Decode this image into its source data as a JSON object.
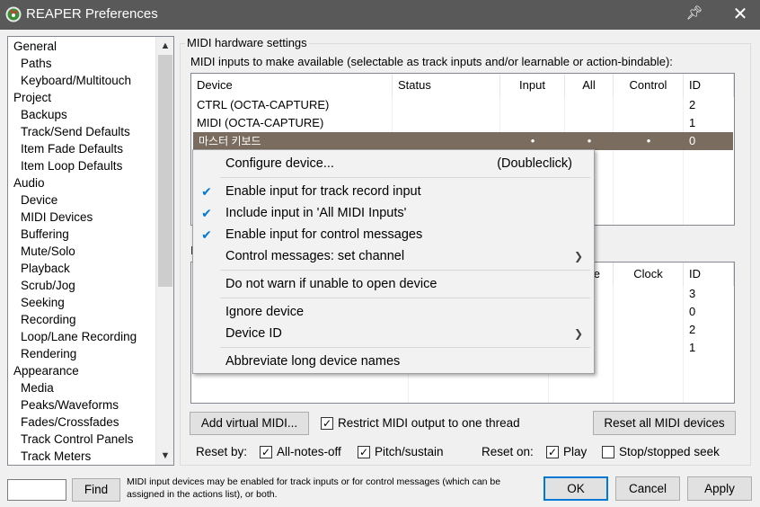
{
  "window": {
    "title": "REAPER Preferences"
  },
  "sidebar": {
    "items": [
      {
        "label": "General",
        "level": "cat"
      },
      {
        "label": "Paths",
        "level": "sub"
      },
      {
        "label": "Keyboard/Multitouch",
        "level": "sub"
      },
      {
        "label": "Project",
        "level": "cat"
      },
      {
        "label": "Backups",
        "level": "sub"
      },
      {
        "label": "Track/Send Defaults",
        "level": "sub"
      },
      {
        "label": "Item Fade Defaults",
        "level": "sub"
      },
      {
        "label": "Item Loop Defaults",
        "level": "sub"
      },
      {
        "label": "Audio",
        "level": "cat"
      },
      {
        "label": "Device",
        "level": "sub"
      },
      {
        "label": "MIDI Devices",
        "level": "sub",
        "selected": true
      },
      {
        "label": "Buffering",
        "level": "sub"
      },
      {
        "label": "Mute/Solo",
        "level": "sub"
      },
      {
        "label": "Playback",
        "level": "sub"
      },
      {
        "label": "Scrub/Jog",
        "level": "sub"
      },
      {
        "label": "Seeking",
        "level": "sub"
      },
      {
        "label": "Recording",
        "level": "sub"
      },
      {
        "label": "Loop/Lane Recording",
        "level": "sub"
      },
      {
        "label": "Rendering",
        "level": "sub"
      },
      {
        "label": "Appearance",
        "level": "cat"
      },
      {
        "label": "Media",
        "level": "sub"
      },
      {
        "label": "Peaks/Waveforms",
        "level": "sub"
      },
      {
        "label": "Fades/Crossfades",
        "level": "sub"
      },
      {
        "label": "Track Control Panels",
        "level": "sub"
      },
      {
        "label": "Track Meters",
        "level": "sub"
      }
    ]
  },
  "main": {
    "group_title": "MIDI hardware settings",
    "inputs_label": "MIDI inputs to make available (selectable as track inputs and/or learnable or action-bindable):",
    "inputs_table": {
      "columns": [
        "Device",
        "Status",
        "Input",
        "All",
        "Control",
        "ID"
      ],
      "rows": [
        {
          "device": "CTRL (OCTA-CAPTURE)",
          "status": "",
          "input": "",
          "all": "",
          "control": "",
          "id": "2"
        },
        {
          "device": "MIDI (OCTA-CAPTURE)",
          "status": "",
          "input": "",
          "all": "",
          "control": "",
          "id": "1"
        },
        {
          "device": "마스터 키보드",
          "status": "",
          "input": "•",
          "all": "•",
          "control": "•",
          "id": "0",
          "selected": true
        }
      ]
    },
    "outputs_label_partial": "I",
    "outputs_table": {
      "columns_visible": [
        "e",
        "Clock",
        "ID"
      ],
      "ids": [
        "3",
        "0",
        "2",
        "1"
      ]
    },
    "add_virtual_button": "Add virtual MIDI...",
    "restrict_checkbox": {
      "label": "Restrict MIDI output to one thread",
      "checked": true
    },
    "reset_all_button": "Reset all MIDI devices",
    "reset_by_label": "Reset by:",
    "all_notes_off": {
      "label": "All-notes-off",
      "checked": true
    },
    "pitch_sustain": {
      "label": "Pitch/sustain",
      "checked": true
    },
    "reset_on_label": "Reset on:",
    "play": {
      "label": "Play",
      "checked": true
    },
    "stop_seek": {
      "label": "Stop/stopped seek",
      "checked": false
    }
  },
  "context_menu": {
    "items": [
      {
        "label": "Configure device...",
        "shortcut": "(Doubleclick)"
      },
      {
        "label": "Enable input for track record input",
        "checked": true
      },
      {
        "label": "Include input in 'All MIDI Inputs'",
        "checked": true
      },
      {
        "label": "Enable input for control messages",
        "checked": true
      },
      {
        "label": "Control messages: set channel",
        "submenu": true
      },
      {
        "label": "Do not warn if unable to open device"
      },
      {
        "label": "Ignore device"
      },
      {
        "label": "Device ID",
        "submenu": true
      },
      {
        "label": "Abbreviate long device names"
      }
    ]
  },
  "bottom": {
    "find_value": "",
    "find_button": "Find",
    "note": "MIDI input devices may be enabled for track inputs or for control messages (which can be assigned in the actions list), or both.",
    "ok": "OK",
    "cancel": "Cancel",
    "apply": "Apply"
  },
  "icons": {
    "logo": "reaper-logo-icon",
    "pin": "pin-icon",
    "close": "close-icon",
    "check": "checkmark-icon",
    "submenu": "chevron-right-icon"
  },
  "colors": {
    "titlebar": "#595959",
    "selected_row": "#7a6d5f",
    "accent": "#0078d7"
  }
}
